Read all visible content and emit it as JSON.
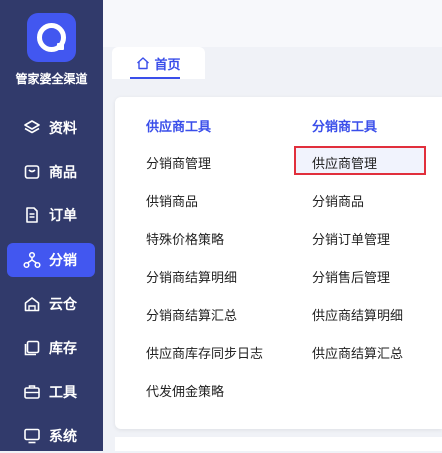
{
  "brand": {
    "name": "管家婆全渠道"
  },
  "sidebar": {
    "items": [
      {
        "label": "资料",
        "icon": "layers-icon",
        "active": false
      },
      {
        "label": "商品",
        "icon": "box-icon",
        "active": false
      },
      {
        "label": "订单",
        "icon": "document-icon",
        "active": false
      },
      {
        "label": "分销",
        "icon": "network-icon",
        "active": true
      },
      {
        "label": "云仓",
        "icon": "cloud-warehouse-icon",
        "active": false
      },
      {
        "label": "库存",
        "icon": "inventory-icon",
        "active": false
      },
      {
        "label": "工具",
        "icon": "toolbox-icon",
        "active": false
      },
      {
        "label": "系统",
        "icon": "monitor-icon",
        "active": false
      }
    ]
  },
  "tabs": [
    {
      "label": "首页",
      "icon": "home-icon",
      "active": true
    }
  ],
  "menu": {
    "columns": [
      {
        "title": "供应商工具",
        "items": [
          "分销商管理",
          "供销商品",
          "特殊价格策略",
          "分销商结算明细",
          "分销商结算汇总",
          "供应商库存同步日志",
          "代发佣金策略"
        ]
      },
      {
        "title": "分销商工具",
        "items": [
          "供应商管理",
          "分销商品",
          "分销订单管理",
          "分销售后管理",
          "供应商结算明细",
          "供应商结算汇总"
        ]
      }
    ],
    "highlighted": "供应商管理"
  },
  "colors": {
    "sidebar_bg": "#313a6b",
    "accent": "#4257f0",
    "highlight_border": "#e12f3c"
  }
}
